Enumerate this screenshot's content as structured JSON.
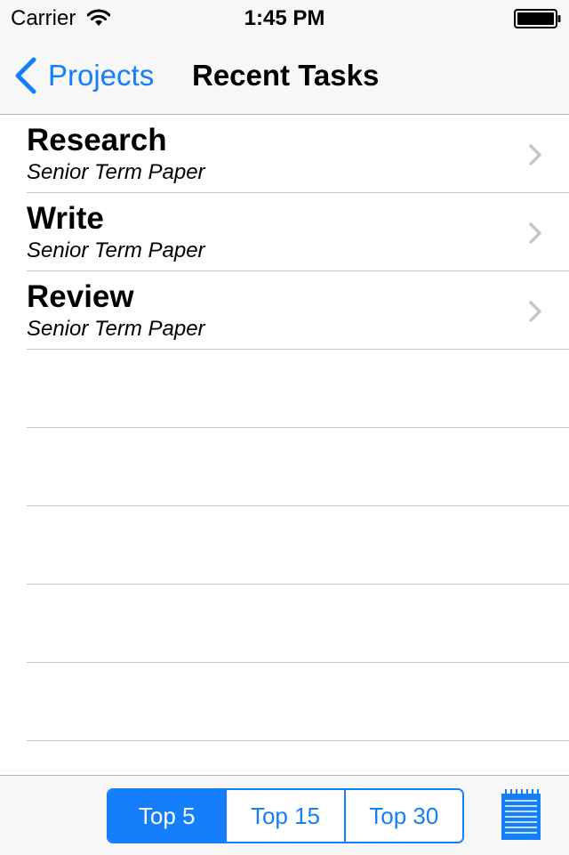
{
  "status_bar": {
    "carrier": "Carrier",
    "time": "1:45 PM",
    "wifi_icon": "wifi-icon",
    "battery_icon": "battery-icon"
  },
  "nav": {
    "back_label": "Projects",
    "back_icon": "chevron-left-icon",
    "title": "Recent Tasks"
  },
  "tasks": [
    {
      "title": "Research",
      "subtitle": "Senior Term Paper"
    },
    {
      "title": "Write",
      "subtitle": "Senior Term Paper"
    },
    {
      "title": "Review",
      "subtitle": "Senior Term Paper"
    }
  ],
  "toolbar": {
    "segments": [
      {
        "label": "Top 5",
        "selected": true
      },
      {
        "label": "Top 15",
        "selected": false
      },
      {
        "label": "Top 30",
        "selected": false
      }
    ],
    "notepad_icon": "notepad-icon"
  },
  "colors": {
    "accent": "#157efb",
    "bar_background": "#f7f7f7",
    "separator": "#c8c7cc",
    "disclosure": "#c7c7cc"
  }
}
